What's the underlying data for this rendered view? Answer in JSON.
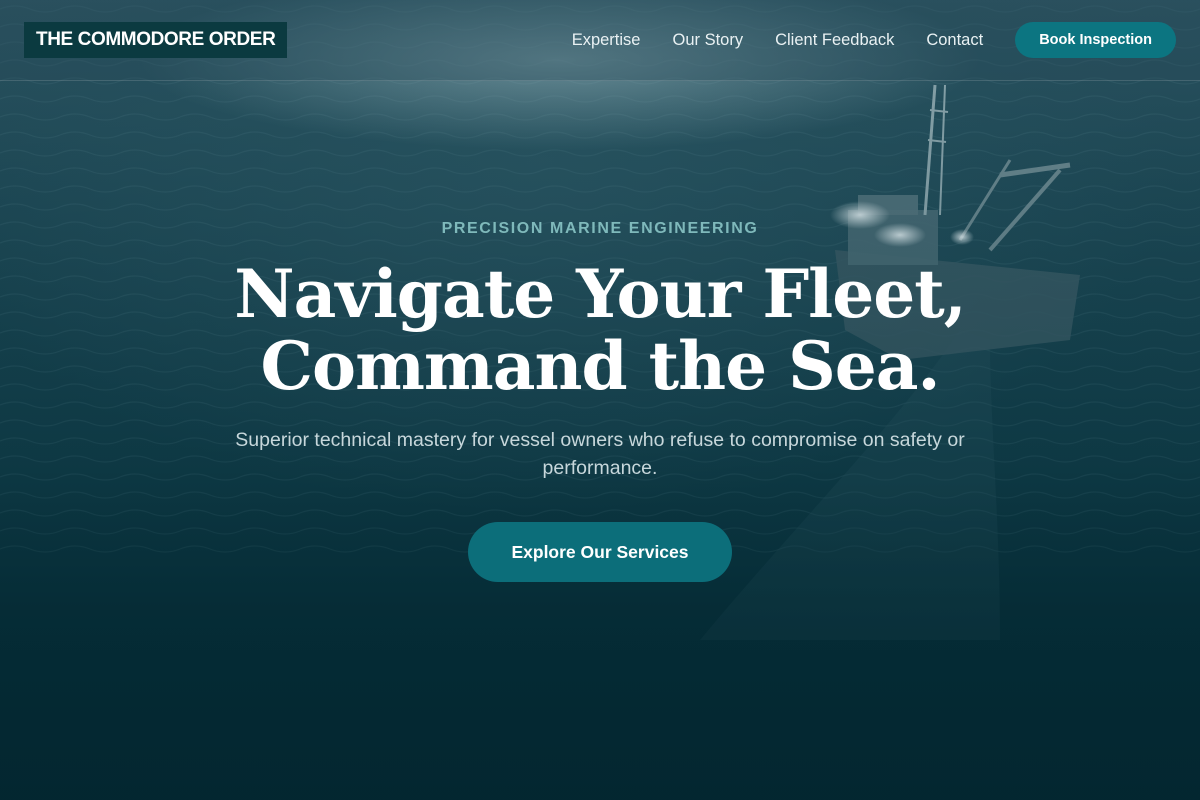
{
  "header": {
    "brand": "THE COMMODORE ORDER",
    "nav": [
      {
        "label": "Expertise"
      },
      {
        "label": "Our Story"
      },
      {
        "label": "Client Feedback"
      },
      {
        "label": "Contact"
      }
    ],
    "cta_label": "Book Inspection"
  },
  "hero": {
    "eyebrow": "PRECISION MARINE ENGINEERING",
    "title_line1": "Navigate Your Fleet,",
    "title_line2": "Command the Sea.",
    "subtitle": "Superior technical mastery for vessel owners who refuse to compromise on safety or performance.",
    "cta_label": "Explore Our Services",
    "background_image": "aerial-ocean-fishing-vessel"
  },
  "colors": {
    "accent": "#0c7581",
    "brand_bg": "#0b3a40",
    "eyebrow": "#7fb9bb",
    "page_bg": "#032a33"
  }
}
